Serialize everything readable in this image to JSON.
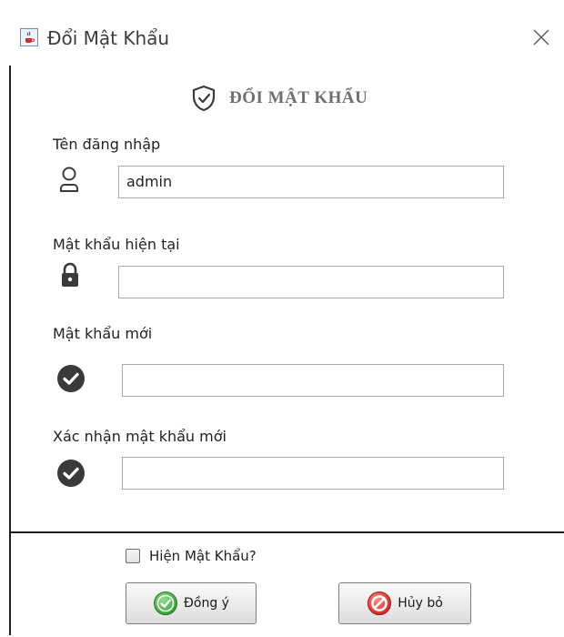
{
  "window": {
    "title": "Đổi Mật Khẩu",
    "app_icon": "java-cup-icon",
    "close_icon": "close-icon"
  },
  "header": {
    "icon": "shield-check-icon",
    "title": "ĐỔI MẬT KHẨU"
  },
  "form": {
    "username": {
      "label": "Tên đăng nhập",
      "icon": "user-icon",
      "value": "admin"
    },
    "current_password": {
      "label": "Mật khẩu hiện tại",
      "icon": "lock-icon",
      "value": ""
    },
    "new_password": {
      "label": "Mật khẩu mới",
      "icon": "check-circle-icon",
      "value": ""
    },
    "confirm_password": {
      "label": "Xác nhận mật khẩu mới",
      "icon": "check-circle-icon",
      "value": ""
    }
  },
  "options": {
    "show_password_label": "Hiện Mật Khẩu?",
    "show_password_checked": false
  },
  "buttons": {
    "ok_label": "Đồng ý",
    "ok_icon": "green-check-icon",
    "cancel_label": "Hủy bỏ",
    "cancel_icon": "red-cancel-icon"
  },
  "colors": {
    "ok_green": "#3fae3f",
    "cancel_red": "#e03030",
    "icon_dark": "#3a3a3a"
  }
}
